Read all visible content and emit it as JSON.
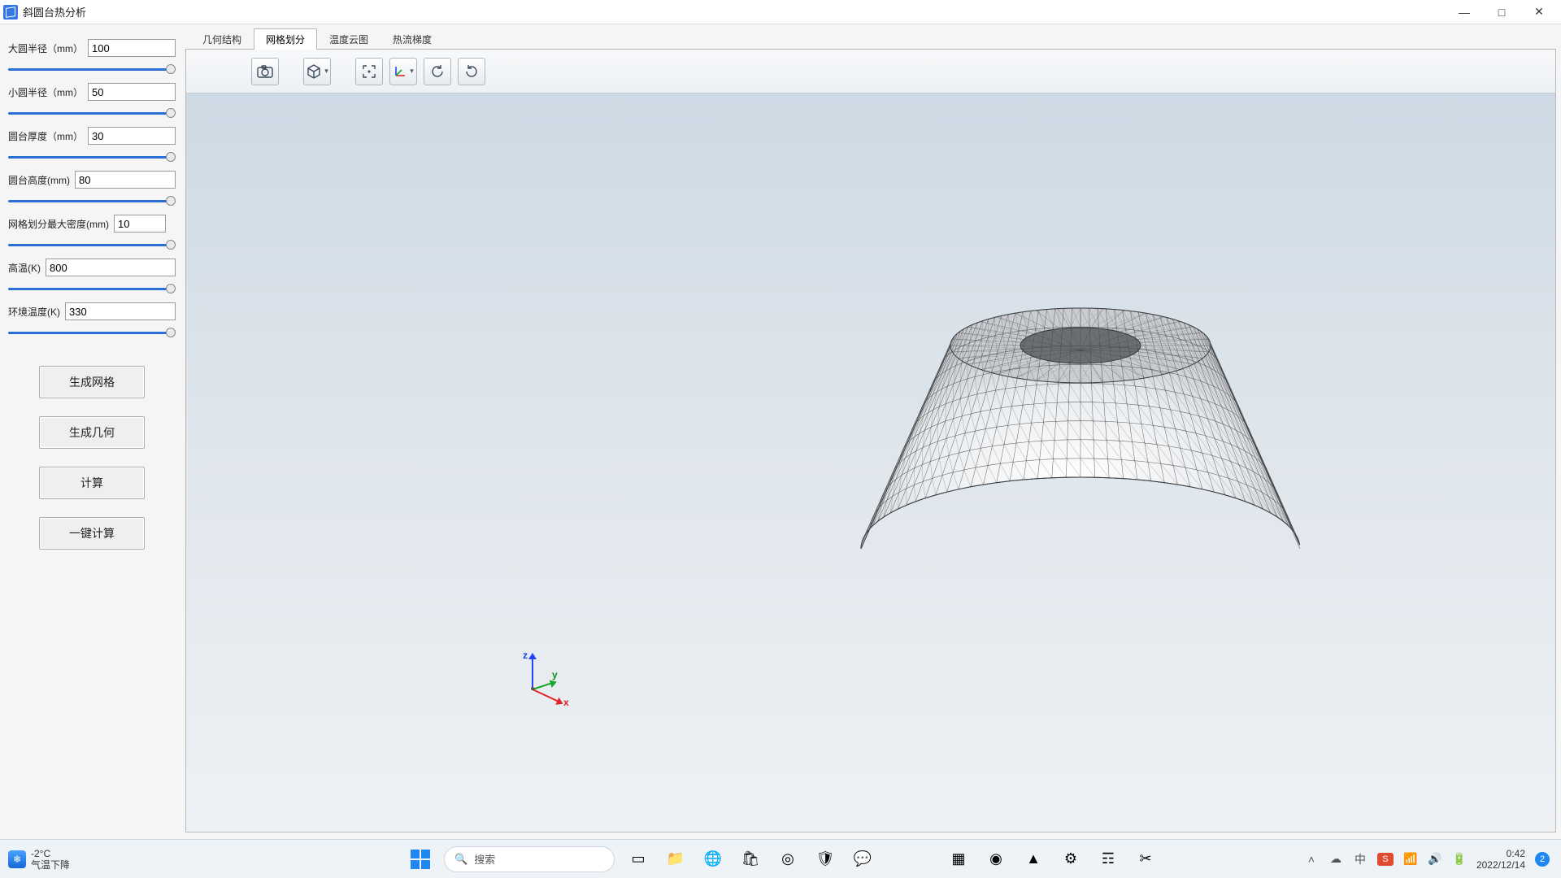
{
  "titlebar": {
    "title": "斜圆台热分析"
  },
  "params": {
    "big_radius": {
      "label": "大圆半径（mm）",
      "value": "100"
    },
    "small_radius": {
      "label": "小圆半径（mm）",
      "value": "50"
    },
    "thickness": {
      "label": "圆台厚度（mm）",
      "value": "30"
    },
    "height": {
      "label": "圆台高度(mm)",
      "value": "80"
    },
    "mesh_density": {
      "label": "网格划分最大密度(mm)",
      "value": "10"
    },
    "high_temp": {
      "label": "高温(K)",
      "value": "800"
    },
    "env_temp": {
      "label": "环境温度(K)",
      "value": "330"
    }
  },
  "buttons": {
    "gen_mesh": "生成网格",
    "gen_geom": "生成几何",
    "compute": "计算",
    "one_click": "一键计算"
  },
  "tabs": {
    "geometry": "几何结构",
    "mesh": "网格划分",
    "temp": "温度云图",
    "flux": "热流梯度"
  },
  "viewer_icons": {
    "camera": "camera-icon",
    "cube": "cube-view-icon",
    "fit": "fit-view-icon",
    "axes": "axes-icon",
    "rotate1": "rotate-ccw-icon",
    "rotate2": "rotate-cw-icon"
  },
  "axes_labels": {
    "x": "x",
    "y": "y",
    "z": "z"
  },
  "taskbar": {
    "weather_temp": "-2°C",
    "weather_desc": "气温下降",
    "search_placeholder": "搜索",
    "time": "0:42",
    "date": "2022/12/14",
    "notif_count": "2"
  }
}
